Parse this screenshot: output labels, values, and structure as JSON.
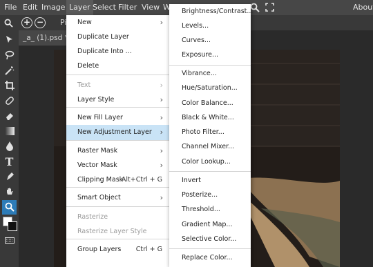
{
  "menubar": {
    "items": [
      "File",
      "Edit",
      "Image",
      "Layer",
      "Select",
      "Filter",
      "View",
      "W"
    ],
    "about": "About"
  },
  "options": {
    "label_partial": "Pi"
  },
  "document": {
    "tab_label": "_a_ (1).psd *",
    "tab_close": "×"
  },
  "layer_menu": {
    "items": [
      {
        "label": "New",
        "submenu": true
      },
      {
        "label": "Duplicate Layer"
      },
      {
        "label": "Duplicate Into ..."
      },
      {
        "label": "Delete"
      },
      {
        "label": "Text",
        "submenu": true,
        "disabled": true
      },
      {
        "label": "Layer Style",
        "submenu": true
      },
      {
        "label": "New Fill Layer",
        "submenu": true
      },
      {
        "label": "New Adjustment Layer",
        "submenu": true,
        "highlighted": true
      },
      {
        "label": "Raster Mask",
        "submenu": true
      },
      {
        "label": "Vector Mask",
        "submenu": true
      },
      {
        "label": "Clipping Mask",
        "shortcut": "Alt+Ctrl + G"
      },
      {
        "label": "Smart Object",
        "submenu": true
      },
      {
        "label": "Rasterize",
        "disabled": true
      },
      {
        "label": "Rasterize Layer Style",
        "disabled": true
      },
      {
        "label": "Group Layers",
        "shortcut": "Ctrl + G"
      }
    ]
  },
  "adjustment_menu": {
    "items": [
      {
        "label": "Brightness/Contrast..."
      },
      {
        "label": "Levels..."
      },
      {
        "label": "Curves..."
      },
      {
        "label": "Exposure..."
      },
      {
        "label": "Vibrance..."
      },
      {
        "label": "Hue/Saturation..."
      },
      {
        "label": "Color Balance..."
      },
      {
        "label": "Black & White..."
      },
      {
        "label": "Photo Filter..."
      },
      {
        "label": "Channel Mixer..."
      },
      {
        "label": "Color Lookup..."
      },
      {
        "label": "Invert"
      },
      {
        "label": "Posterize..."
      },
      {
        "label": "Threshold..."
      },
      {
        "label": "Gradient Map..."
      },
      {
        "label": "Selective Color..."
      },
      {
        "label": "Replace Color..."
      }
    ]
  },
  "icons": {
    "submenu_arrow": "›",
    "zoom_in": "+",
    "zoom_out": "−"
  },
  "colors": {
    "highlight": "#c9e3f6",
    "active_tool": "#2d7cb8",
    "menubar": "#474747"
  }
}
